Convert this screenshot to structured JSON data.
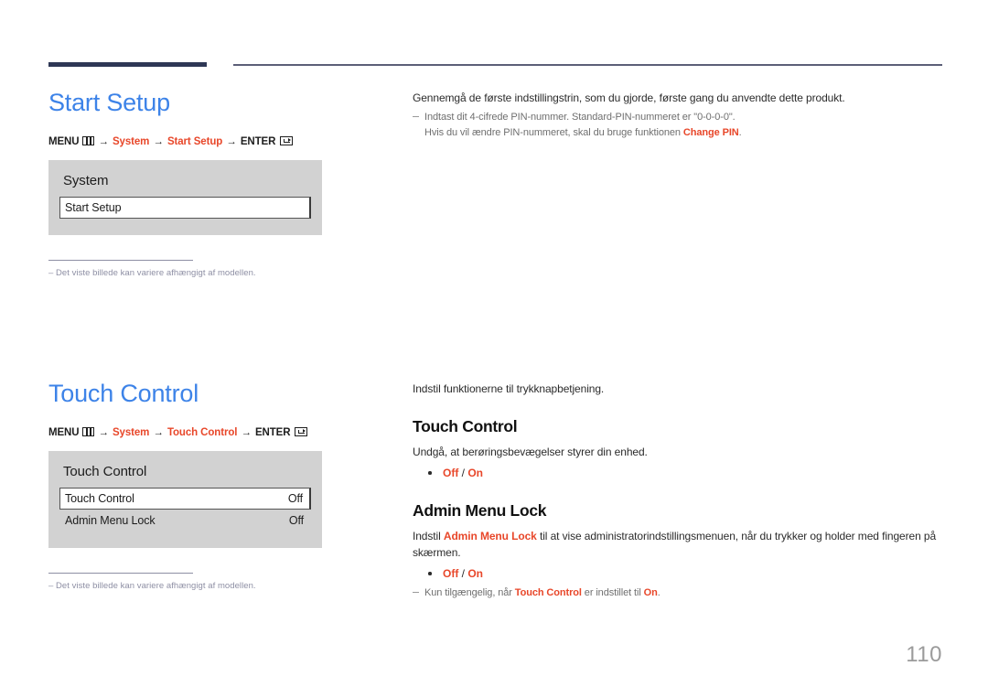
{
  "page": {
    "number": "110"
  },
  "sections": [
    {
      "id": "start-setup",
      "heading": "Start Setup",
      "menu_path": {
        "prefix": "MENU",
        "menu_icon": "menu-icon",
        "arrow": "→",
        "item1": "System",
        "item2": "Start Setup",
        "enter": "ENTER",
        "enter_icon": "enter-key-icon"
      },
      "osd": {
        "title": "System",
        "rows": [
          {
            "label": "Start Setup",
            "value": "",
            "selected": true
          }
        ]
      },
      "footnote": "–  Det viste billede kan variere afhængigt af modellen.",
      "right": {
        "intro": "Gennemgå de første indstillingstrin, som du gjorde, første gang du anvendte dette produkt.",
        "note_line1": "Indtast dit 4-cifrede PIN-nummer. Standard-PIN-nummeret er \"0-0-0-0\".",
        "note_line2_pre": "Hvis du vil ændre PIN-nummeret, skal du bruge funktionen ",
        "note_line2_accent": "Change PIN",
        "note_line2_post": "."
      }
    },
    {
      "id": "touch-control",
      "heading": "Touch Control",
      "menu_path": {
        "prefix": "MENU",
        "menu_icon": "menu-icon",
        "arrow": "→",
        "item1": "System",
        "item2": "Touch Control",
        "enter": "ENTER",
        "enter_icon": "enter-key-icon"
      },
      "osd": {
        "title": "Touch Control",
        "rows": [
          {
            "label": "Touch Control",
            "value": "Off",
            "selected": true
          },
          {
            "label": "Admin Menu Lock",
            "value": "Off",
            "selected": false
          }
        ]
      },
      "footnote": "–  Det viste billede kan variere afhængigt af modellen.",
      "right": {
        "intro": "Indstil funktionerne til trykknapbetjening.",
        "sub1": {
          "heading": "Touch Control",
          "body": "Undgå, at berøringsbevægelser styrer din enhed.",
          "option_off": "Off",
          "option_sep": " / ",
          "option_on": "On"
        },
        "sub2": {
          "heading": "Admin Menu Lock",
          "body_pre": "Indstil ",
          "body_accent": "Admin Menu Lock",
          "body_post": " til at vise administratorindstillingsmenuen, når du trykker og holder med fingeren på skærmen.",
          "option_off": "Off",
          "option_sep": " / ",
          "option_on": "On",
          "note_pre": "Kun tilgængelig, når ",
          "note_accent1": "Touch Control",
          "note_mid": " er indstillet til ",
          "note_accent2": "On",
          "note_post": "."
        }
      }
    }
  ],
  "colors": {
    "heading_blue": "#3d83e8",
    "accent_orange": "#e8472a",
    "rule_dark": "#2e3755",
    "panel_gray": "#d2d2d2",
    "footnote_gray": "#8e8fa4",
    "page_number_gray": "#9b9b9b"
  }
}
